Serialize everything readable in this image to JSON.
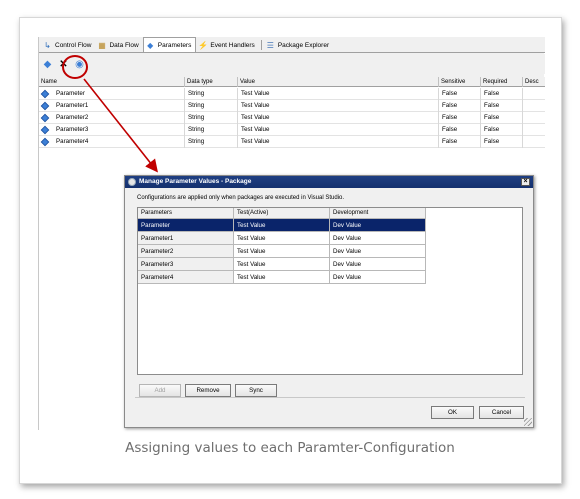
{
  "designer": {
    "tabs": [
      {
        "label": "Control Flow",
        "icon": "control-flow-icon"
      },
      {
        "label": "Data Flow",
        "icon": "data-flow-icon"
      },
      {
        "label": "Parameters",
        "icon": "parameters-icon",
        "active": true
      },
      {
        "label": "Event Handlers",
        "icon": "event-handlers-icon"
      },
      {
        "label": "Package Explorer",
        "icon": "package-explorer-icon"
      }
    ],
    "toolbar": [
      "add-parameter-icon",
      "delete-parameter-icon",
      "manage-parameter-values-icon"
    ],
    "columns": [
      "Name",
      "Data type",
      "Value",
      "Sensitive",
      "Required",
      "Desc"
    ],
    "rows": [
      {
        "name": "Parameter",
        "type": "String",
        "value": "Test Value",
        "sensitive": "False",
        "required": "False"
      },
      {
        "name": "Parameter1",
        "type": "String",
        "value": "Test Value",
        "sensitive": "False",
        "required": "False"
      },
      {
        "name": "Parameter2",
        "type": "String",
        "value": "Test Value",
        "sensitive": "False",
        "required": "False"
      },
      {
        "name": "Parameter3",
        "type": "String",
        "value": "Test Value",
        "sensitive": "False",
        "required": "False"
      },
      {
        "name": "Parameter4",
        "type": "String",
        "value": "Test Value",
        "sensitive": "False",
        "required": "False"
      }
    ]
  },
  "dialog": {
    "title": "Manage Parameter Values - Package",
    "info": "Configurations are applied only when packages are executed in Visual Studio.",
    "columns": [
      "Parameters",
      "Test(Active)",
      "Development"
    ],
    "rows": [
      {
        "name": "Parameter",
        "test": "Test Value",
        "dev": "Dev Value"
      },
      {
        "name": "Parameter1",
        "test": "Test Value",
        "dev": "Dev Value"
      },
      {
        "name": "Parameter2",
        "test": "Test Value",
        "dev": "Dev Value"
      },
      {
        "name": "Parameter3",
        "test": "Test Value",
        "dev": "Dev Value"
      },
      {
        "name": "Parameter4",
        "test": "Test Value",
        "dev": "Dev Value"
      }
    ],
    "selected_row": 0,
    "buttons": {
      "add": "Add",
      "remove": "Remove",
      "sync": "Sync",
      "ok": "OK",
      "cancel": "Cancel"
    },
    "close": "×"
  },
  "caption": "Assigning values to each Paramter-Configuration",
  "colors": {
    "highlight": "#c00000",
    "selection": "#0a246a",
    "titlebar": "#1f3f82"
  }
}
